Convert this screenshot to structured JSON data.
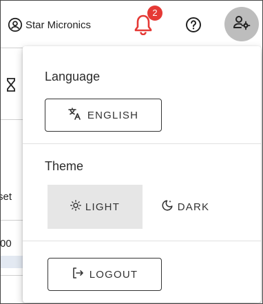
{
  "header": {
    "organization": "Star Micronics",
    "notification_count": "2"
  },
  "background_page": {
    "partial_text_1": "set",
    "partial_text_2": "00"
  },
  "menu": {
    "language": {
      "title": "Language",
      "button_label": "ENGLISH"
    },
    "theme": {
      "title": "Theme",
      "options": [
        {
          "label": "LIGHT",
          "selected": true
        },
        {
          "label": "DARK",
          "selected": false
        }
      ]
    },
    "logout_label": "LOGOUT"
  },
  "colors": {
    "bell": "#e53935",
    "badge": "#e53935",
    "selected_option_bg": "#e6e6e6",
    "user_button_bg": "#bdbdbd"
  },
  "icons": {
    "organization": "account-circle-icon",
    "notifications": "bell-icon",
    "help": "help-circle-icon",
    "user_settings": "user-settings-icon",
    "language": "translate-icon",
    "light": "sun-icon",
    "dark": "moon-icon",
    "logout": "logout-icon",
    "background": "hourglass-icon"
  }
}
